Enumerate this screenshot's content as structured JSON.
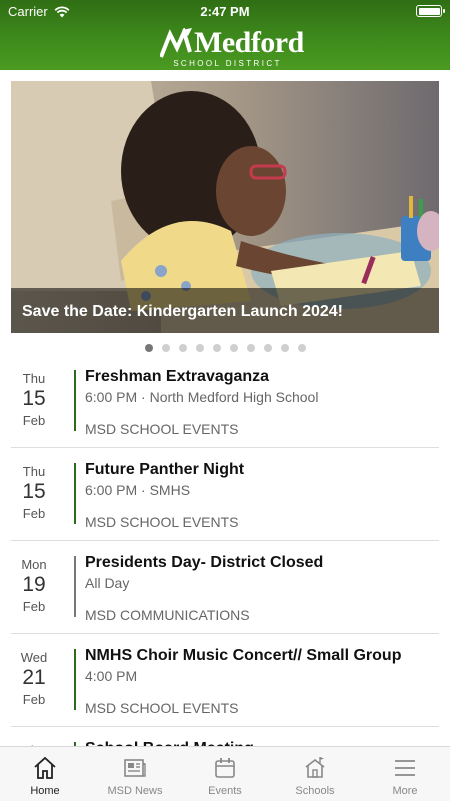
{
  "status_bar": {
    "carrier": "Carrier",
    "time": "2:47 PM"
  },
  "header": {
    "logo_word": "Medford",
    "logo_subtitle": "SCHOOL DISTRICT",
    "logo_color": "#ffffff",
    "bar_color": "#3e8a1c"
  },
  "hero": {
    "caption": "Save the Date: Kindergarten Launch 2024!"
  },
  "carousel": {
    "count": 10,
    "active_index": 0
  },
  "events": [
    {
      "dow": "Thu",
      "day": "15",
      "month": "Feb",
      "title": "Freshman Extravaganza",
      "meta": "6:00 PM · North Medford High School",
      "category": "MSD SCHOOL EVENTS",
      "bar_color": "#2d6b1c"
    },
    {
      "dow": "Thu",
      "day": "15",
      "month": "Feb",
      "title": "Future Panther Night",
      "meta": "6:00 PM · SMHS",
      "category": "MSD SCHOOL EVENTS",
      "bar_color": "#2d6b1c"
    },
    {
      "dow": "Mon",
      "day": "19",
      "month": "Feb",
      "title": "Presidents Day- District Closed",
      "meta": "All Day",
      "category": "MSD COMMUNICATIONS",
      "bar_color": "#777777"
    },
    {
      "dow": "Wed",
      "day": "21",
      "month": "Feb",
      "title": "NMHS Choir Music Concert// Small Group",
      "meta": "4:00 PM",
      "category": "MSD SCHOOL EVENTS",
      "bar_color": "#2d6b1c"
    },
    {
      "dow": "Thu",
      "day": "",
      "month": "",
      "title": "School Board Meeting",
      "meta": "",
      "category": "",
      "bar_color": "#2d6b1c"
    }
  ],
  "tabbar": {
    "items": [
      {
        "label": "Home",
        "icon": "home-icon",
        "active": true
      },
      {
        "label": "MSD News",
        "icon": "news-icon",
        "active": false
      },
      {
        "label": "Events",
        "icon": "calendar-icon",
        "active": false
      },
      {
        "label": "Schools",
        "icon": "school-icon",
        "active": false
      },
      {
        "label": "More",
        "icon": "menu-icon",
        "active": false
      }
    ]
  }
}
